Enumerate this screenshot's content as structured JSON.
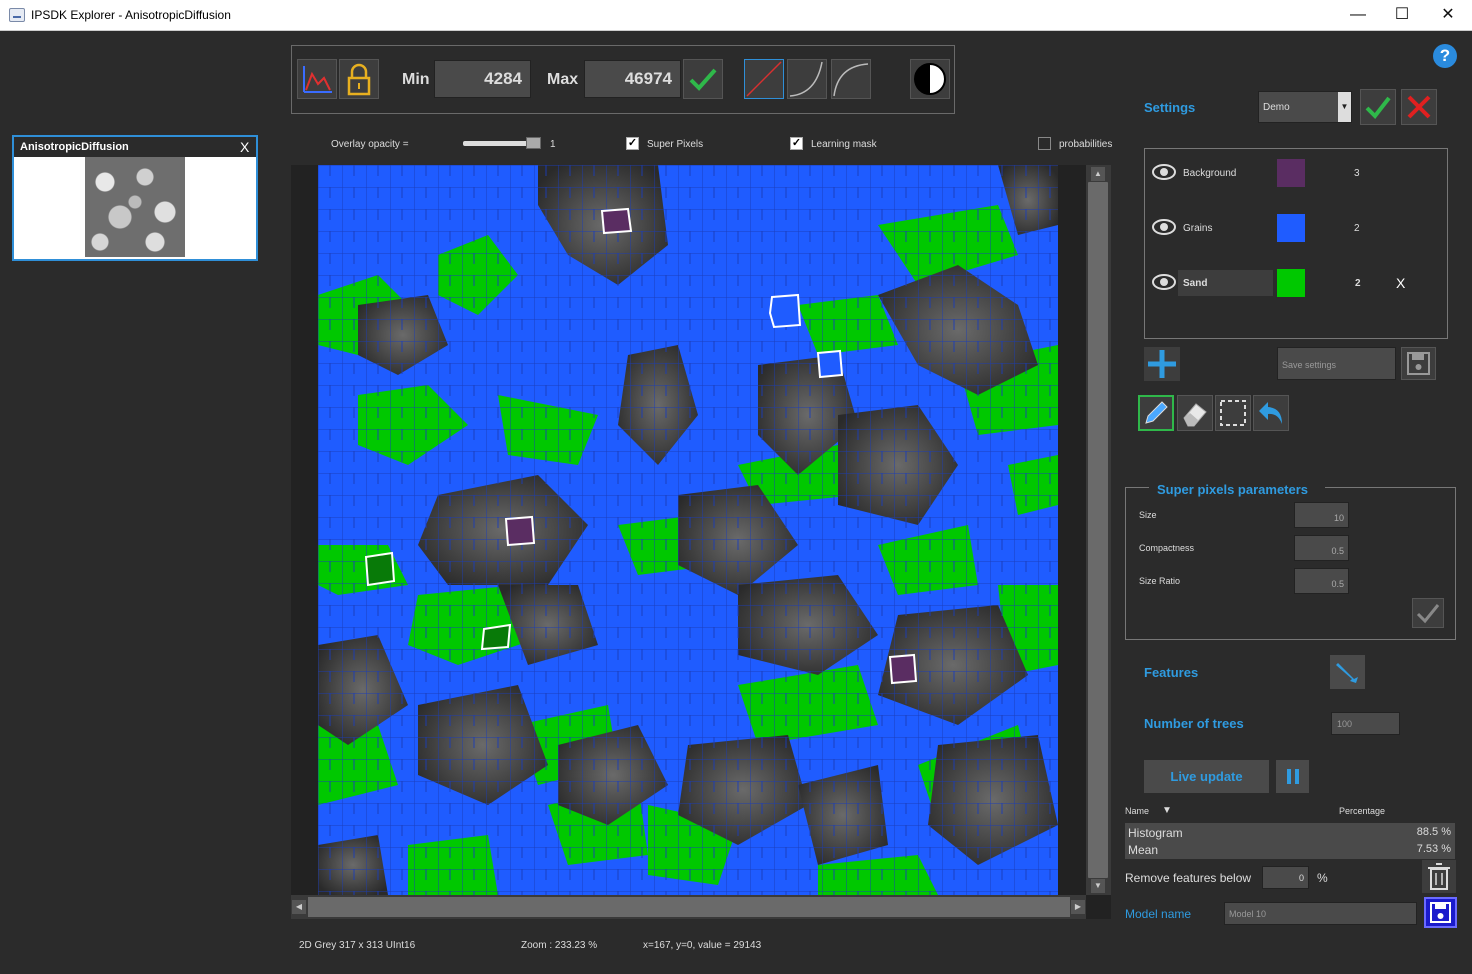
{
  "window": {
    "title": "IPSDK Explorer - AnisotropicDiffusion",
    "minimize_glyph": "—",
    "maximize_glyph": "☐",
    "close_glyph": "✕"
  },
  "help": {
    "label": "?"
  },
  "thumbnail": {
    "title": "AnisotropicDiffusion",
    "close_label": "X"
  },
  "toolbar": {
    "min_label": "Min",
    "min_value": "4284",
    "max_label": "Max",
    "max_value": "46974",
    "icons": [
      "histogram-icon",
      "lock-icon",
      "apply-check-icon",
      "linear-curve-icon",
      "exponential-curve-icon",
      "log-curve-icon",
      "contrast-icon"
    ]
  },
  "options": {
    "overlay_opacity_label": "Overlay opacity =",
    "overlay_opacity_value": "1",
    "overlay_opacity_level": 1.0,
    "super_pixels_label": "Super Pixels",
    "super_pixels_checked": true,
    "learning_mask_label": "Learning mask",
    "learning_mask_checked": true,
    "probabilities_label": "probabilities",
    "probabilities_checked": false
  },
  "status": {
    "image_info": "2D Grey 317 x 313 UInt16",
    "zoom": "Zoom : 233.23 %",
    "cursor": "x=167, y=0, value = 29143"
  },
  "settings": {
    "title": "Settings",
    "preset": "Demo",
    "dropdown_glyph": "▼"
  },
  "labels": [
    {
      "name": "Background",
      "color": "#5a2d62",
      "count": "3"
    },
    {
      "name": "Grains",
      "color": "#1f5cff",
      "count": "2"
    },
    {
      "name": "Sand",
      "color": "#00c800",
      "count": "2",
      "delete_label": "X"
    }
  ],
  "save_settings": {
    "placeholder": "Save settings"
  },
  "super_pixels": {
    "title": "Super pixels parameters",
    "size_label": "Size",
    "size_value": "10",
    "compactness_label": "Compactness",
    "compactness_value": "0.5",
    "size_ratio_label": "Size Ratio",
    "size_ratio_value": "0.5"
  },
  "features": {
    "title": "Features"
  },
  "trees": {
    "title": "Number of trees",
    "value": "100"
  },
  "live_update": {
    "label": "Live update"
  },
  "feature_table": {
    "name_header": "Name",
    "sort_glyph": "▼",
    "pct_header": "Percentage",
    "rows": [
      {
        "name": "Histogram",
        "pct": "88.5 %"
      },
      {
        "name": "Mean",
        "pct": "7.53 %"
      }
    ]
  },
  "remove_features": {
    "label": "Remove features below",
    "value": "0",
    "unit": "%"
  },
  "model": {
    "label": "Model name",
    "value": "Model 10"
  },
  "colors": {
    "accent": "#2f9be0",
    "overlay_grains": "#1f5cff",
    "overlay_sand": "#00c800",
    "overlay_background": "#5a2d62"
  }
}
